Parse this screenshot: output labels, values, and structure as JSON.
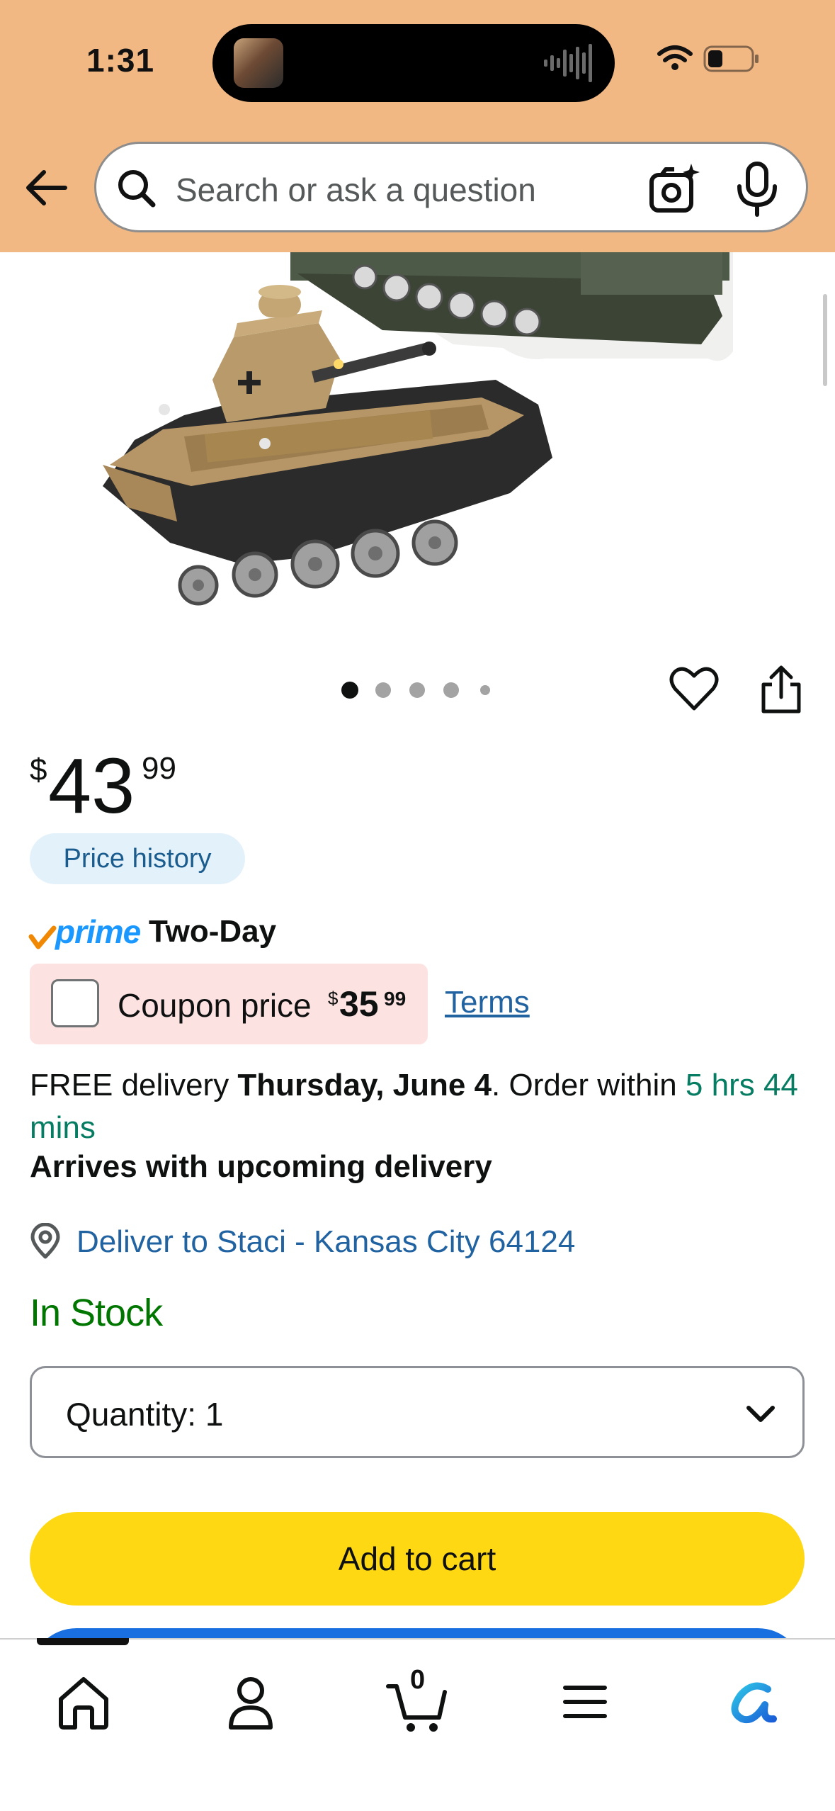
{
  "status_bar": {
    "time": "1:31"
  },
  "header": {
    "search_placeholder": "Search or ask a question",
    "background_color": "#f2b884"
  },
  "product": {
    "image_description_icon": "lego-tank-image",
    "carousel": {
      "total": 5,
      "active": 1
    },
    "price": {
      "symbol": "$",
      "whole": "43",
      "fraction": "99"
    },
    "price_history_label": "Price history",
    "prime": {
      "brand": "prime",
      "speed": "Two-Day"
    },
    "coupon": {
      "label": "Coupon price",
      "symbol": "$",
      "whole": "35",
      "fraction": "99",
      "checked": false
    },
    "terms_label": "Terms",
    "delivery": {
      "prefix": "FREE delivery ",
      "date": "Thursday, June 4",
      "middle": ". Order within ",
      "cutoff": "5 hrs 44 mins"
    },
    "arrives_note": "Arrives with upcoming delivery",
    "deliver_to": "Deliver to Staci - Kansas City 64124",
    "stock_status": "In Stock",
    "quantity_label": "Quantity:",
    "quantity_value": "1",
    "add_to_cart_label": "Add to cart"
  },
  "bottom_nav": {
    "items": [
      {
        "name": "home",
        "icon": "home-icon"
      },
      {
        "name": "account",
        "icon": "person-icon"
      },
      {
        "name": "cart",
        "icon": "cart-icon",
        "count": "0"
      },
      {
        "name": "menu",
        "icon": "menu-icon"
      },
      {
        "name": "rufus",
        "icon": "rufus-icon"
      }
    ]
  },
  "colors": {
    "accent_yellow": "#ffd814",
    "link_blue": "#2162a1",
    "stock_green": "#007600",
    "prime_blue": "#1a98ff",
    "coupon_bg": "#fde2e2"
  }
}
